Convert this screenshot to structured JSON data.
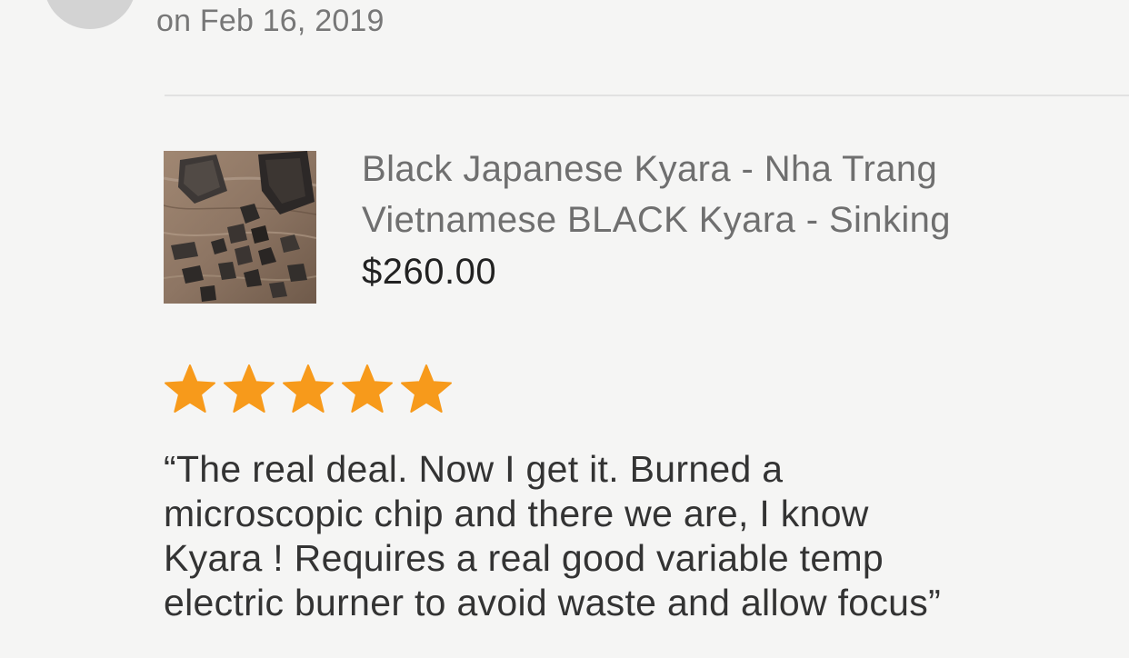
{
  "review": {
    "date": "on Feb 16, 2019",
    "rating": 5,
    "rating_max": 5,
    "text_lines": [
      "“The real deal. Now I get it. Burned a",
      "microscopic chip and there we are, I know",
      "Kyara ! Requires a real good variable temp",
      "electric burner to avoid waste and allow focus”"
    ]
  },
  "listing": {
    "title_lines": [
      "Black Japanese Kyara - Nha Trang",
      "Vietnamese BLACK Kyara - Sinking"
    ],
    "price": "$260.00"
  },
  "colors": {
    "star": "#f79a1b",
    "background": "#f5f5f4",
    "title_text": "#6f6f6f",
    "body_text": "#333333"
  },
  "icons": {
    "rating": "star-icon",
    "avatar": "user-avatar"
  }
}
